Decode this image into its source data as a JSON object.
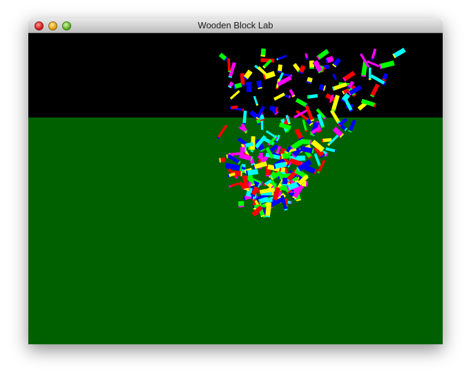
{
  "window": {
    "title": "Wooden Block Lab"
  },
  "controls": {
    "close_icon": "close-icon",
    "minimize_icon": "minimize-icon",
    "zoom_icon": "zoom-icon"
  },
  "scene": {
    "sky_color": "#000000",
    "ground_color": "#006000",
    "block_colors": [
      "#0000ff",
      "#00ff00",
      "#00ffff",
      "#ff00ff",
      "#ffff00",
      "#ff0000"
    ]
  }
}
